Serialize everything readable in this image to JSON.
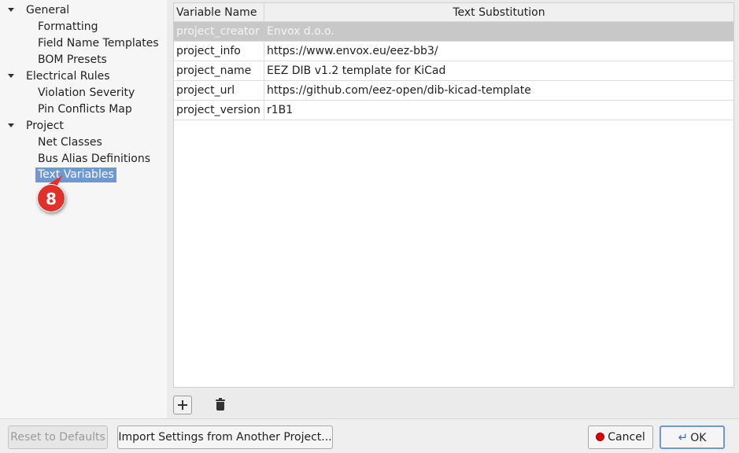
{
  "tree": {
    "items": [
      {
        "label": "General",
        "kind": "group"
      },
      {
        "label": "Formatting",
        "kind": "leaf"
      },
      {
        "label": "Field Name Templates",
        "kind": "leaf"
      },
      {
        "label": "BOM Presets",
        "kind": "leaf"
      },
      {
        "label": "Electrical Rules",
        "kind": "group"
      },
      {
        "label": "Violation Severity",
        "kind": "leaf"
      },
      {
        "label": "Pin Conflicts Map",
        "kind": "leaf"
      },
      {
        "label": "Project",
        "kind": "group"
      },
      {
        "label": "Net Classes",
        "kind": "leaf"
      },
      {
        "label": "Bus Alias Definitions",
        "kind": "leaf"
      },
      {
        "label": "Text Variables",
        "kind": "leaf",
        "selected": true
      }
    ]
  },
  "badge": {
    "text": "8",
    "color": "#e0312a"
  },
  "grid": {
    "headers": [
      "Variable Name",
      "Text Substitution"
    ],
    "rows": [
      {
        "name": "project_creator",
        "value": "Envox d.o.o."
      },
      {
        "name": "project_info",
        "value": "https://www.envox.eu/eez-bb3/"
      },
      {
        "name": "project_name",
        "value": "EEZ DIB v1.2 template for KiCad"
      },
      {
        "name": "project_url",
        "value": "https://github.com/eez-open/dib-kicad-template"
      },
      {
        "name": "project_version",
        "value": "r1B1"
      }
    ],
    "selected_row": 0
  },
  "toolbar": {
    "add_icon": "plus-icon",
    "delete_icon": "trash-icon"
  },
  "buttons": {
    "reset": "Reset to Defaults",
    "import": "Import Settings from Another Project...",
    "cancel": "Cancel",
    "ok": "OK"
  },
  "colors": {
    "selection": "#6e98d4",
    "badge": "#e0312a",
    "cancel_icon": "#e00000"
  }
}
